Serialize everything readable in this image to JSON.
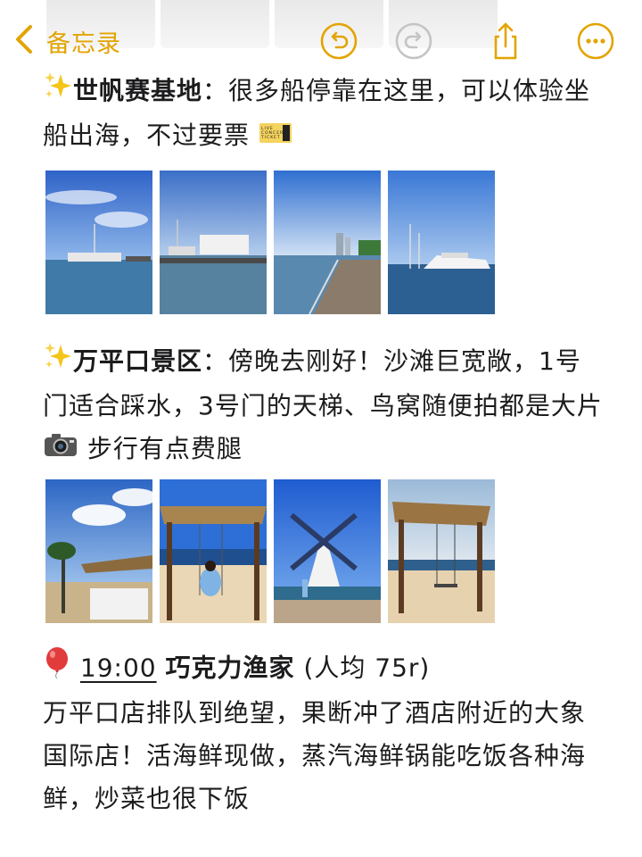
{
  "header": {
    "back_label": "备忘录",
    "accent_color": "#e3a400",
    "icons": [
      "chevron-left-icon",
      "undo-icon",
      "redo-icon",
      "share-icon",
      "more-icon"
    ]
  },
  "sections": [
    {
      "emoji": "sparkles",
      "title": "世帆赛基地",
      "separator": "：",
      "body": "很多船停靠在这里，可以体验坐船出海，不过要票",
      "trailing_emoji": "ticket",
      "ticket_text": [
        "LIVE",
        "CONCERT",
        "TICKET"
      ],
      "photos": [
        "marina-boats-photo",
        "marina-yachts-photo",
        "boardwalk-photo",
        "yacht-photo"
      ]
    },
    {
      "emoji": "sparkles",
      "title": "万平口景区",
      "separator": "：",
      "body_part1": "傍晚去刚好！沙滩巨宽敞，1号门适合踩水，3号门的天梯、鸟窝随便拍都是大片",
      "trailing_emoji": "camera",
      "body_part2": "步行有点费腿",
      "photos": [
        "beach-hut-photo",
        "swing-girl-photo",
        "windmill-photo",
        "beach-swing-photo"
      ]
    },
    {
      "emoji": "balloon",
      "time": "19:00",
      "title": "巧克力渔家",
      "price": "(人均 75r)",
      "body": "万平口店排队到绝望，果断冲了酒店附近的大象国际店！活海鲜现做，蒸汽海鲜锅能吃饭各种海鲜，炒菜也很下饭"
    }
  ]
}
